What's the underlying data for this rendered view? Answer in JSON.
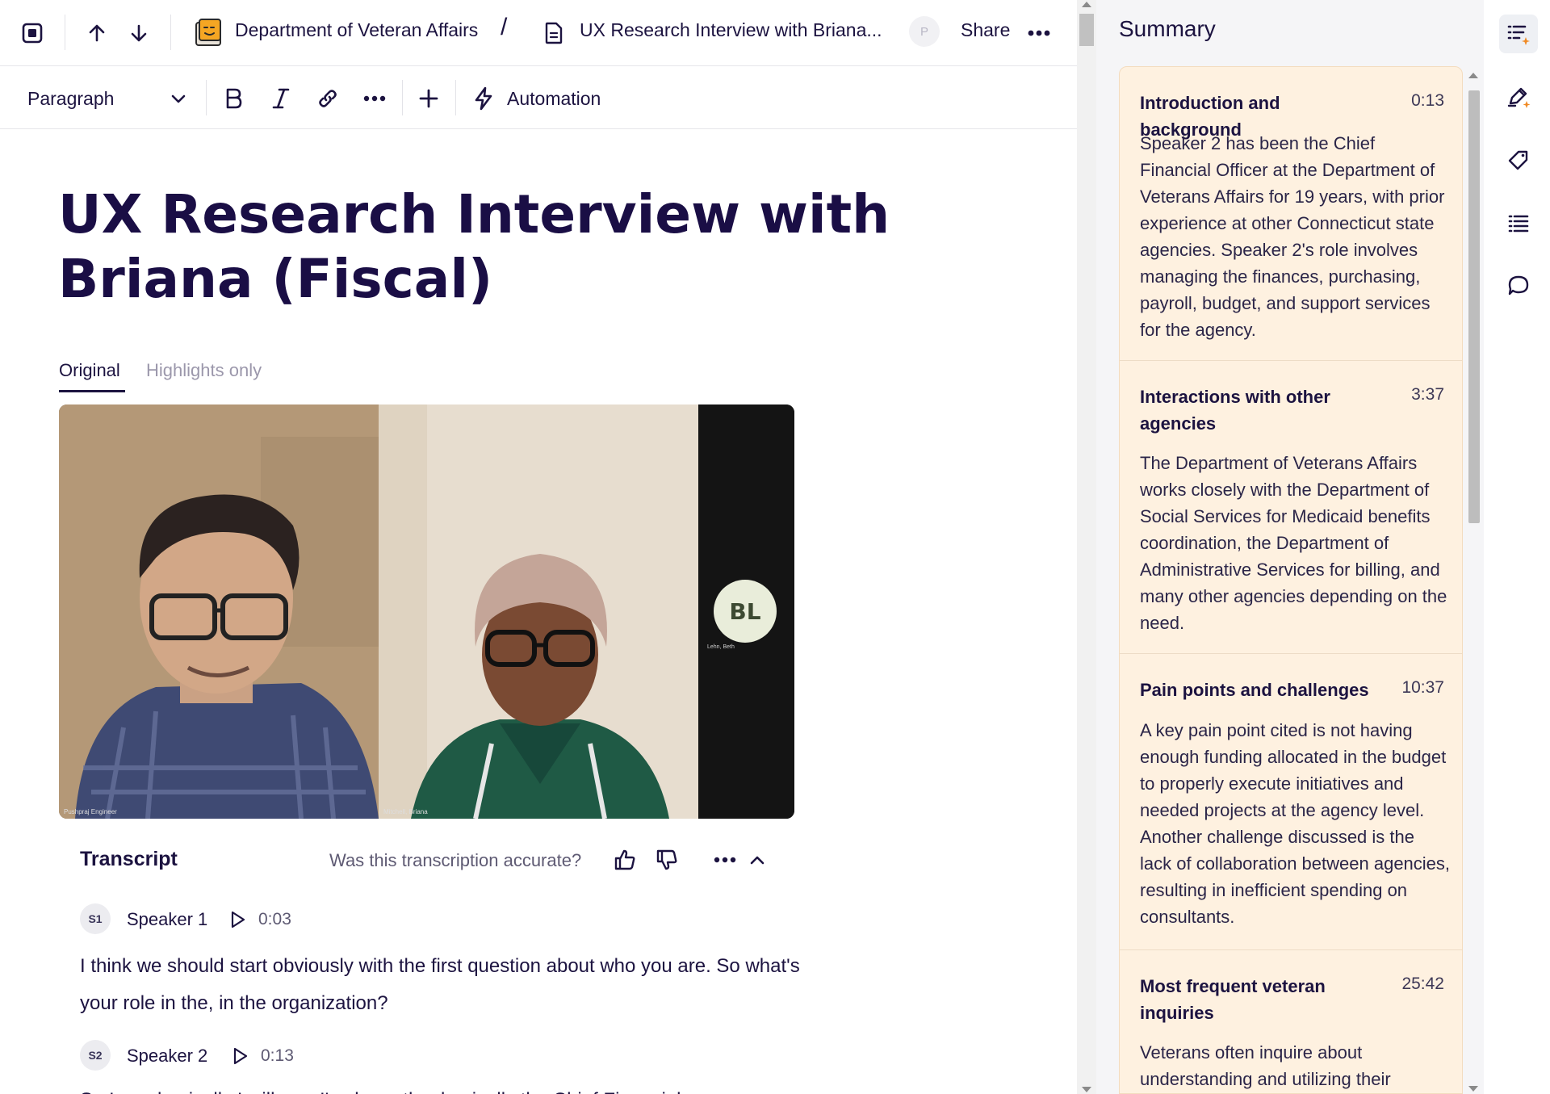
{
  "topbar": {
    "workspace": "Department of Veteran Affairs",
    "separator": "/",
    "doc_crumb": "UX Research Interview with Briana...",
    "presence_initial": "P",
    "share_label": "Share"
  },
  "toolbar": {
    "block_type": "Paragraph",
    "automation_label": "Automation"
  },
  "doc": {
    "title": "UX Research Interview with Briana (Fiscal)"
  },
  "tabs": [
    {
      "label": "Original",
      "active": true
    },
    {
      "label": "Highlights only",
      "active": false
    }
  ],
  "video": {
    "participant_1_caption": "Pushpraj Engineer",
    "participant_2_caption": "Mitchell, Briana",
    "participant_3_initials": "BL",
    "participant_3_caption": "Lehn, Beth"
  },
  "transcript": {
    "label": "Transcript",
    "accuracy_question": "Was this transcription accurate?",
    "utterances": [
      {
        "badge": "S1",
        "speaker": "Speaker 1",
        "time": "0:03",
        "text": "I think we should start obviously with the first question about who you are. So what's your role in the, in the organization?"
      },
      {
        "badge": "S2",
        "speaker": "Speaker 2",
        "time": "0:13",
        "text": "So I am, basically I will say, I've been the, basically the Chief Financial..."
      }
    ]
  },
  "summary": {
    "title": "Summary",
    "sections": [
      {
        "heading": "Introduction and background",
        "time": "0:13",
        "body": "Speaker 2 has been the Chief Financial Officer at the Department of Veterans Affairs for 19 years, with prior experience at other Connecticut state agencies. Speaker 2's role involves managing the finances, purchasing, payroll, budget, and support services for the agency."
      },
      {
        "heading": "Interactions with other agencies",
        "time": "3:37",
        "body": "The Department of Veterans Affairs works closely with the Department of Social Services for Medicaid benefits coordination, the Department of Administrative Services for billing, and many other agencies depending on the need."
      },
      {
        "heading": "Pain points and challenges",
        "time": "10:37",
        "body": "A key pain point cited is not having enough funding allocated in the budget to properly execute initiatives and needed projects at the agency level. Another challenge discussed is the lack of collaboration between agencies, resulting in inefficient spending on consultants."
      },
      {
        "heading": "Most frequent veteran inquiries",
        "time": "25:42",
        "body": "Veterans often inquire about understanding and utilizing their"
      }
    ]
  },
  "colors": {
    "accent_text": "#1c1340",
    "summary_card_bg": "#fef1e0",
    "panel_bg": "#f5f5f7",
    "rail_accent": "#f08a24"
  },
  "icons": {
    "rail": [
      "summary-list-icon",
      "ai-highlight-icon",
      "tag-icon",
      "list-icon",
      "comment-icon"
    ]
  }
}
